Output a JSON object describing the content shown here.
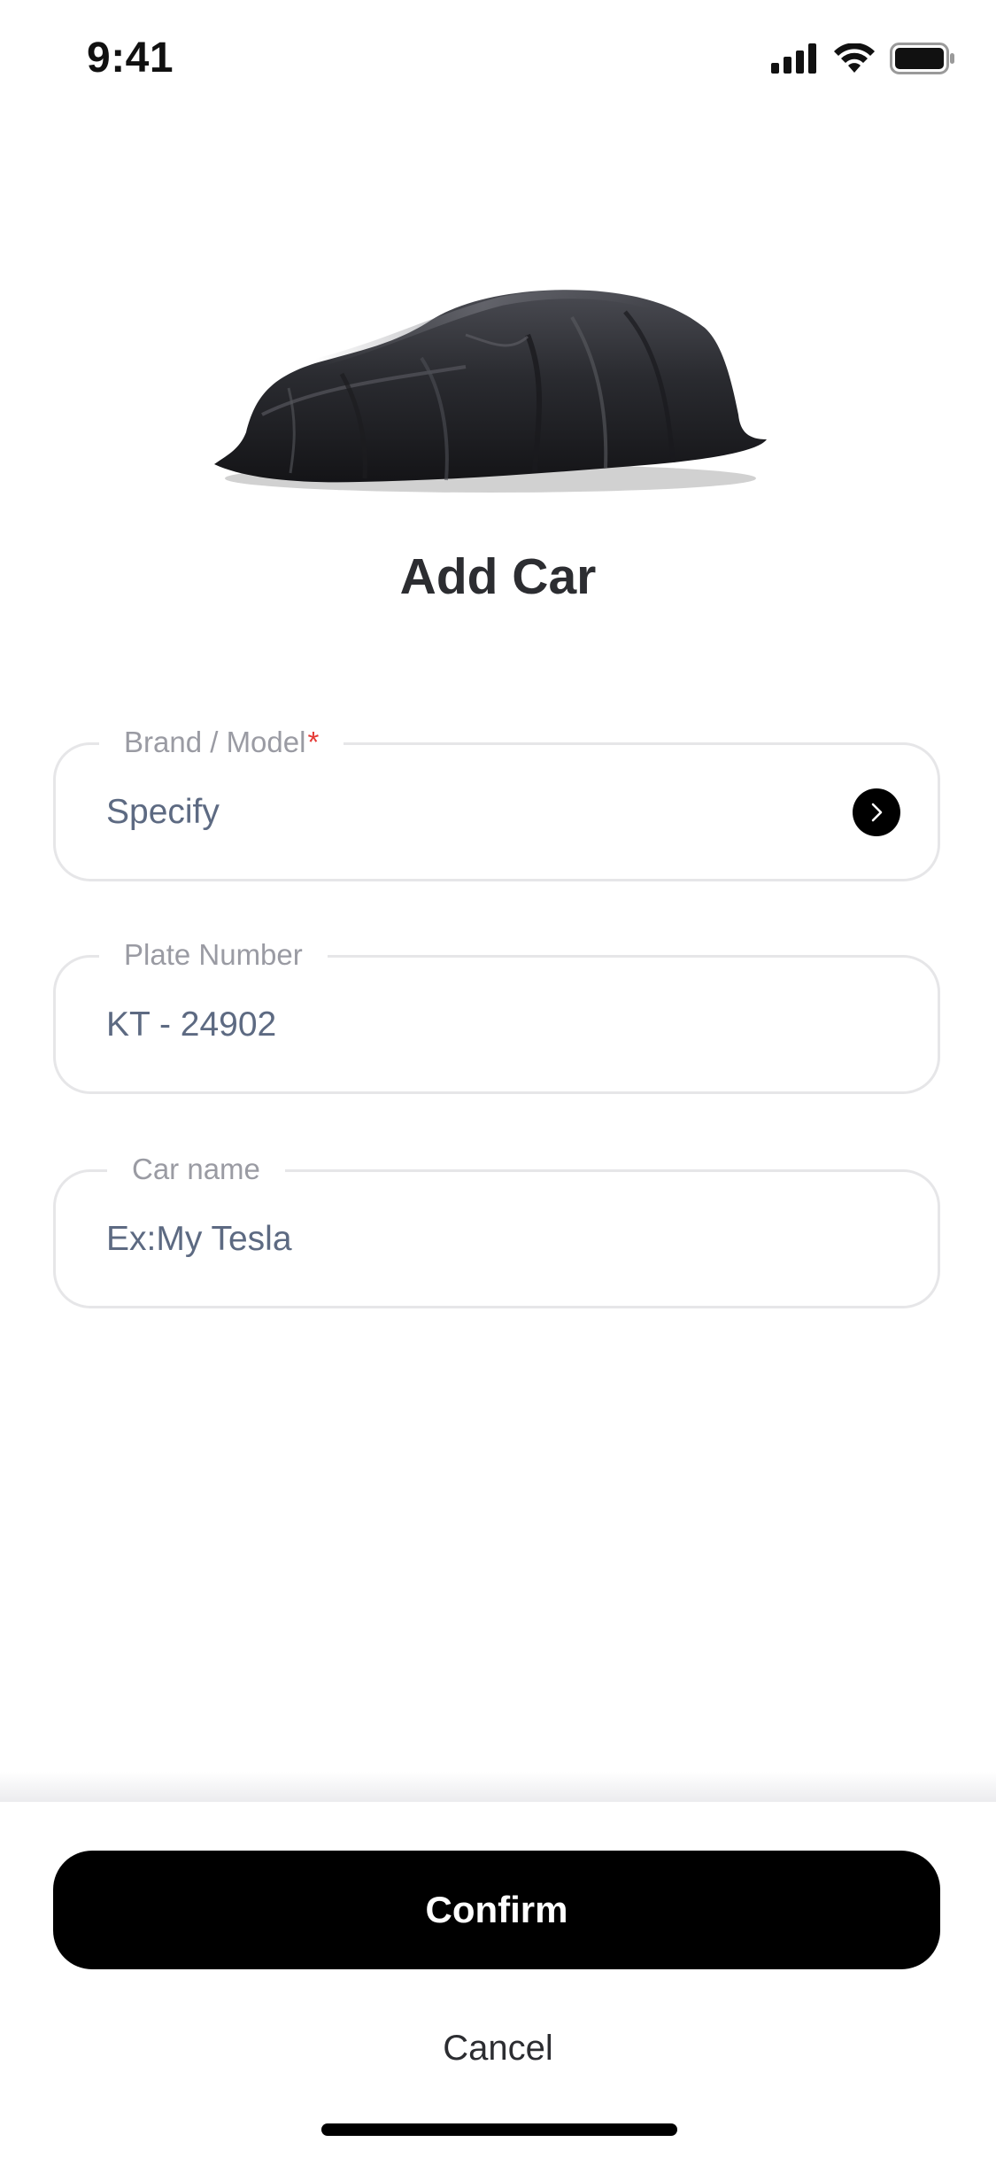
{
  "status_bar": {
    "time": "9:41",
    "signal_icon": "cellular-signal-icon",
    "wifi_icon": "wifi-icon",
    "battery_icon": "battery-icon"
  },
  "hero": {
    "image": "covered-car-illustration"
  },
  "title": "Add Car",
  "form": {
    "brand_model": {
      "label": "Brand / Model",
      "required_marker": "*",
      "value": "Specify",
      "action_icon": "chevron-right-icon"
    },
    "plate_number": {
      "label": "Plate Number",
      "value": "KT - 24902"
    },
    "car_name": {
      "label": "Car name",
      "placeholder": "Ex:My Tesla"
    }
  },
  "actions": {
    "confirm_label": "Confirm",
    "cancel_label": "Cancel"
  },
  "colors": {
    "primary_button": "#000000",
    "required": "#e53935",
    "field_border": "#e6e6e8",
    "label_text": "#9a9ba3",
    "value_text": "#5d6a82"
  }
}
